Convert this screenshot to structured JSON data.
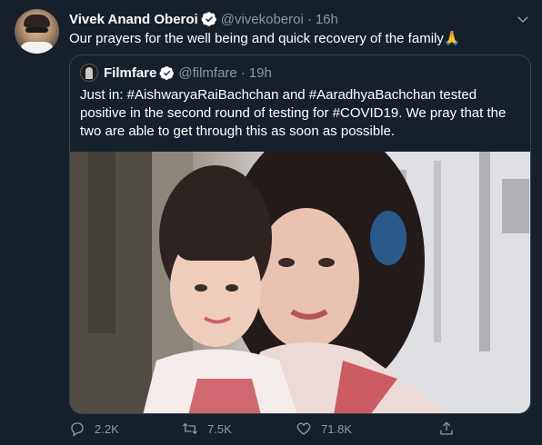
{
  "tweet": {
    "display_name": "Vivek Anand Oberoi",
    "handle": "@vivekoberoi",
    "separator": "·",
    "time": "16h",
    "text": "Our prayers for the well being and quick recovery of the family🙏"
  },
  "quoted_tweet": {
    "display_name": "Filmfare",
    "handle": "@filmfare",
    "separator": "·",
    "time": "19h",
    "text": "Just in: #AishwaryaRaiBachchan and #AaradhyaBachchan tested positive in the second round of testing for #COVID19. We pray that the two are able to get through this as soon as possible."
  },
  "actions": {
    "reply_count": "2.2K",
    "retweet_count": "7.5K",
    "like_count": "71.8K"
  },
  "icons": [
    "verified-badge-icon",
    "chevron-down-icon",
    "reply-icon",
    "retweet-icon",
    "like-icon",
    "share-icon"
  ],
  "colors": {
    "background": "#15202b",
    "text_primary": "#ffffff",
    "text_secondary": "#8899a6",
    "verified": "#ffffff",
    "border": "#38444d"
  }
}
